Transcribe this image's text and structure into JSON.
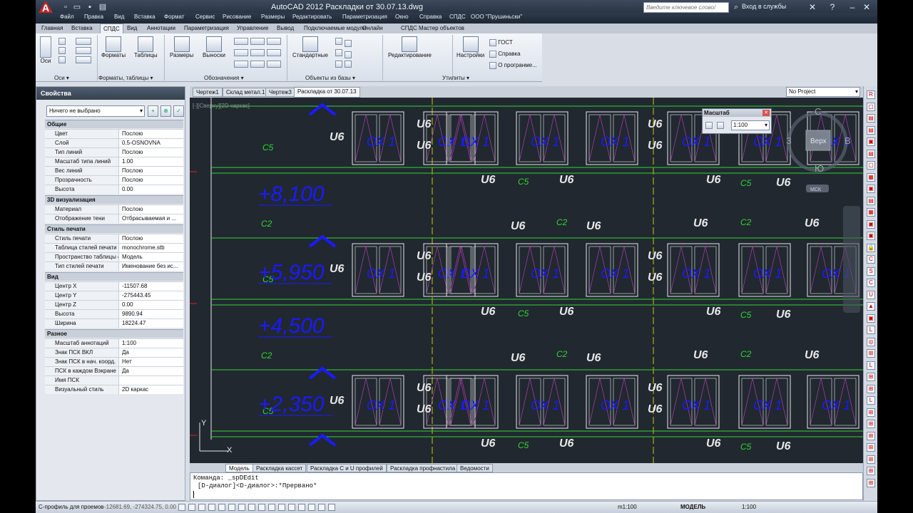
{
  "title": "AutoCAD 2012    Раскладки от 30.07.13.dwg",
  "search_placeholder": "Введите ключевое слово/фразу",
  "signin": "Вход в службы",
  "menu": [
    "Файл",
    "Правка",
    "Вид",
    "Вставка",
    "Формат",
    "Сервис",
    "Рисование",
    "Размеры",
    "Редактировать",
    "Параметризация",
    "Окно",
    "Справка",
    "СПДС",
    "ООО \"Прушиньски\""
  ],
  "ribbon_tabs": [
    "Главная",
    "Вставка",
    "СПДС",
    "Вид",
    "Аннотации",
    "Параметризация",
    "Управление",
    "Вывод",
    "Подключаемые модули",
    "Онлайн",
    "СПДС Мастер объектов"
  ],
  "ribbon": {
    "axes": "Оси",
    "formats": "Форматы",
    "tables": "Таблицы",
    "sizes": "Размеры",
    "leaders": "Выноски",
    "standard": "Стандартные",
    "edit": "Редактирование",
    "settings": "Настройки",
    "gost": "ГОСТ",
    "help": "Справка",
    "about": "О програнме...",
    "panel_axes": "Оси ▾",
    "panel_formats": "Форматы, таблицы ▾",
    "panel_marks": "Обозначения ▾",
    "panel_objects": "Объекты из базы ▾",
    "panel_utils": "Утилиты ▾"
  },
  "properties": {
    "title": "Свойства",
    "selection": "Ничего не выбрано",
    "sections": [
      {
        "name": "Общие",
        "rows": [
          [
            "Цвет",
            "Послою"
          ],
          [
            "Слой",
            "0.5-OSNOVNA"
          ],
          [
            "Тип линий",
            "Послою"
          ],
          [
            "Масштаб типа линий",
            "1.00"
          ],
          [
            "Вес линий",
            "Послою"
          ],
          [
            "Прозрачность",
            "Послою"
          ],
          [
            "Высота",
            "0.00"
          ]
        ]
      },
      {
        "name": "3D визуализация",
        "rows": [
          [
            "Материал",
            "Послою"
          ],
          [
            "Отображение тени",
            "Отбрасываемая и ..."
          ]
        ]
      },
      {
        "name": "Стиль печати",
        "rows": [
          [
            "Стиль печати",
            "Послою"
          ],
          [
            "Таблица стилей печати",
            "monochrome.stb"
          ],
          [
            "Пространство таблицы с...",
            "Модель"
          ],
          [
            "Тип стилей печати",
            "Именование без ис..."
          ]
        ]
      },
      {
        "name": "Вид",
        "rows": [
          [
            "Центр X",
            "-11507.68"
          ],
          [
            "Центр Y",
            "-275443.45"
          ],
          [
            "Центр Z",
            "0.00"
          ],
          [
            "Высота",
            "9890.94"
          ],
          [
            "Ширина",
            "18224.47"
          ]
        ]
      },
      {
        "name": "Разное",
        "rows": [
          [
            "Масштаб аннотаций",
            "1:100"
          ],
          [
            "Знак ПСК ВКЛ",
            "Да"
          ],
          [
            "Знак ПСК в нач. коорд.",
            "Нет"
          ],
          [
            "ПСК в каждом Вэкране",
            "Да"
          ],
          [
            "Имя ПСК",
            ""
          ],
          [
            "Визуальный стиль",
            "2D каркас"
          ]
        ]
      }
    ]
  },
  "doc_tabs": [
    "Чертеж1",
    "Склад метал.1",
    "Чертеж3",
    "Раскладка от 30.07.13"
  ],
  "project": "No Project",
  "sheet_tabs": [
    "Модель",
    "Раскладка кассет",
    "Раскладка С и U профилей",
    "Раскладка профнастила",
    "Ведомости"
  ],
  "command_lines": [
    "Команда: _spDEdit",
    "[D-диалог]<D-диалог>:*Прервано*"
  ],
  "status": {
    "hint": "С-профиль для проемов",
    "coords": "-12681.69, -274324.75, 0.00",
    "scale_label": "m1:100",
    "model": "МОДЕЛЬ",
    "annot_scale": "1:100"
  },
  "scale_dialog": {
    "title": "Масштаб",
    "value": "1:100"
  },
  "viewcube": {
    "top": "Верх",
    "n": "С",
    "s": "Ю",
    "e": "В",
    "w": "З",
    "wcs": "МСК"
  },
  "viewport_label": "[-][Сверху][2D каркас]",
  "drawing": {
    "levels": [
      "+8,100",
      "+5,950",
      "+4,500",
      "+2,350"
    ],
    "profile": "U6",
    "c2": "C2",
    "c5": "C5",
    "panel": "ОХ 1"
  },
  "colors": {
    "canvas": "#212830",
    "green": "#2fd62f",
    "yellow": "#c8c800",
    "blue": "#1a1aff",
    "white": "#e8e8e8",
    "magenta": "#c040c0"
  }
}
